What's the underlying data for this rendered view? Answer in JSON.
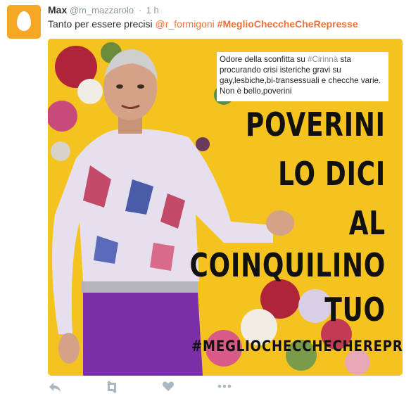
{
  "author": {
    "name": "Max",
    "handle": "@m_mazzarolo",
    "time": "1 h"
  },
  "tweet": {
    "text": "Tanto per essere precisi",
    "mention": "@r_formigoni",
    "hashtag": "#MeglioChecche​CheRepresse"
  },
  "media": {
    "quote_prefix": "Odore della sconfitta su ",
    "quote_hashtag": "#Cirinnà",
    "quote_suffix": " sta procurando crisi isteriche gravi su gay,lesbiche,bi-transessuali e checche varie. Non è bello,poverini",
    "slogan": [
      "POVERINI",
      "LO DICI",
      "AL",
      "COINQUILINO",
      "TUO"
    ],
    "banner_hashtag": "#MEGLIOCHECCHECHEREPRESSE"
  },
  "actions": [
    {
      "name": "reply-icon"
    },
    {
      "name": "retweet-icon"
    },
    {
      "name": "like-icon"
    },
    {
      "name": "more-icon"
    }
  ],
  "colors": {
    "brand_orange": "#e8743b",
    "image_yellow": "#f4c320"
  }
}
